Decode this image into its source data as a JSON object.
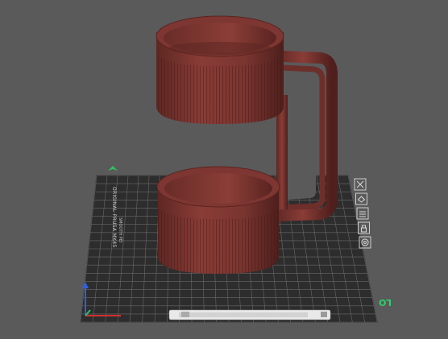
{
  "scene": {
    "background_color": "#5a5a5a",
    "bed_color": "#2d2d2d",
    "grid_color": "#6e6e6e",
    "model_color": "#7a3530",
    "model_shadow_color": "#4e1f1c",
    "accent_color": "#30d06a"
  },
  "bed": {
    "left_label": "ORIGINAL PRUSA MK4S",
    "left_label_line2": "SMOOTH PEI",
    "bottom_right_badge": "LO"
  },
  "toolbar": {
    "icons": [
      {
        "name": "close-icon"
      },
      {
        "name": "view-icon"
      },
      {
        "name": "layer-icon"
      },
      {
        "name": "lock-icon"
      },
      {
        "name": "gear-icon"
      }
    ]
  },
  "axes": {
    "x_color": "#d03030",
    "y_color": "#30c060",
    "z_color": "#3060e0"
  }
}
